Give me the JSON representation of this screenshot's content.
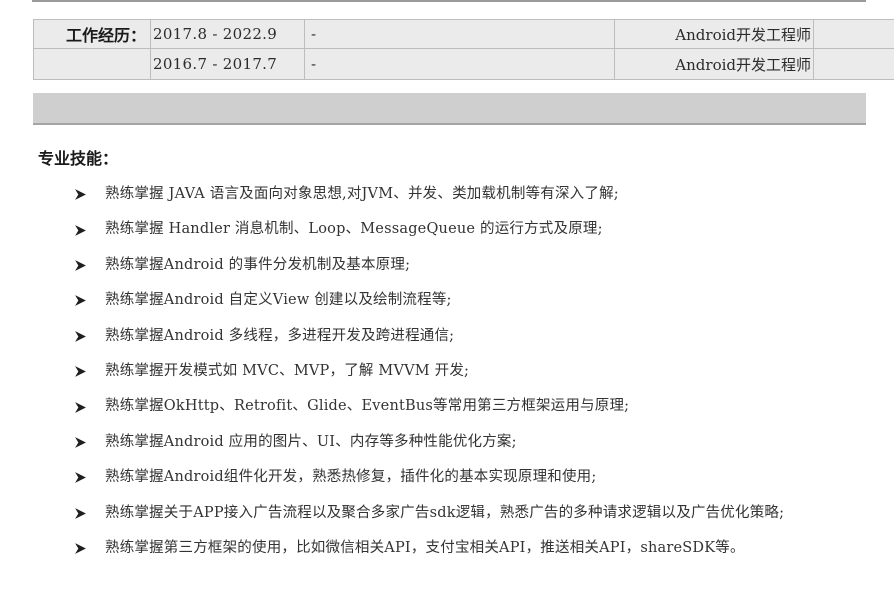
{
  "work_experience": {
    "label": "工作经历：",
    "rows": [
      {
        "period": "2017.8 - 2022.9",
        "company": "-",
        "role": "Android开发工程师"
      },
      {
        "period": "2016.7 - 2017.7",
        "company": "-",
        "role": "Android开发工程师"
      }
    ]
  },
  "skills": {
    "title": "专业技能：",
    "bullet_icon": "arrow-bullet-icon",
    "items": [
      "熟练掌握 JAVA 语言及面向对象思想,对JVM、并发、类加载机制等有深入了解;",
      "熟练掌握 Handler 消息机制、Loop、MessageQueue 的运行方式及原理;",
      "熟练掌握Android 的事件分发机制及基本原理;",
      "熟练掌握Android 自定义View 创建以及绘制流程等;",
      "熟练掌握Android 多线程，多进程开发及跨进程通信;",
      "熟练掌握开发模式如 MVC、MVP，了解 MVVM 开发;",
      "熟练掌握OkHttp、Retrofit、Glide、EventBus等常用第三方框架运用与原理;",
      "熟练掌握Android 应用的图片、UI、内存等多种性能优化方案;",
      "熟练掌握Android组件化开发，熟悉热修复，插件化的基本实现原理和使用;",
      "熟练掌握关于APP接入广告流程以及聚合多家广告sdk逻辑，熟悉广告的多种请求逻辑以及广告优化策略;",
      "熟练掌握第三方框架的使用，比如微信相关API，支付宝相关API，推送相关API，shareSDK等。"
    ]
  },
  "colors": {
    "table_bg": "#ebebeb",
    "band_bg": "#cfcfcf",
    "text": "#333333"
  }
}
